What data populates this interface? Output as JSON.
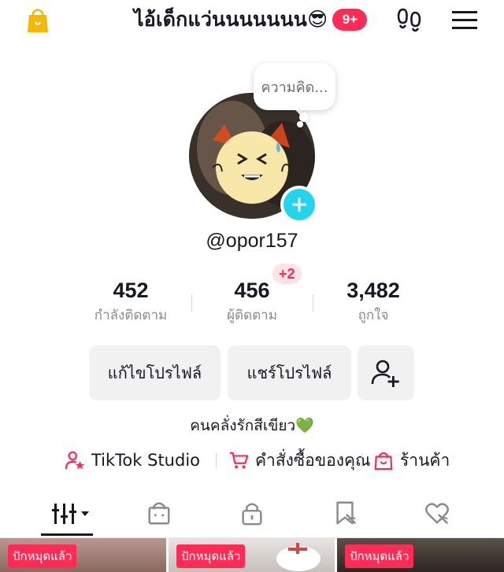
{
  "header": {
    "title": "ไอ้เด็กแว่นนนนนนน😎",
    "notification_count": "9+"
  },
  "profile": {
    "thought_bubble": "ความคิด...",
    "username": "@opor157",
    "bio": "คนคลั่งรักสีเขียว💚"
  },
  "stats": {
    "following": {
      "value": "452",
      "label": "กำลังติดตาม"
    },
    "followers": {
      "value": "456",
      "label": "ผู้ติดตาม",
      "new_badge": "+2"
    },
    "likes": {
      "value": "3,482",
      "label": "ถูกใจ"
    }
  },
  "actions": {
    "edit_profile": "แก้ไขโปรไฟล์",
    "share_profile": "แชร์โปรไฟล์"
  },
  "quick_links": [
    {
      "label": "TikTok Studio",
      "icon": "person-star-icon"
    },
    {
      "label": "คำสั่งซื้อของคุณ",
      "icon": "cart-icon"
    },
    {
      "label": "ร้านค้า",
      "icon": "shop-bag-icon"
    }
  ],
  "tabs": [
    {
      "icon": "videos-grid-icon",
      "active": true
    },
    {
      "icon": "shop-bag-icon"
    },
    {
      "icon": "lock-icon"
    },
    {
      "icon": "saved-bookmark-icon"
    },
    {
      "icon": "liked-heart-icon"
    }
  ],
  "thumbnails": [
    {
      "label": "ปักหมุดแล้ว"
    },
    {
      "label": "ปักหมุดแล้ว"
    },
    {
      "label": "ปักหมุดแล้ว"
    }
  ],
  "colors": {
    "accent": "#fe2c55",
    "add_button": "#20d5ec",
    "button_bg": "#f1f1f2",
    "shop_icon": "#f5b800"
  }
}
